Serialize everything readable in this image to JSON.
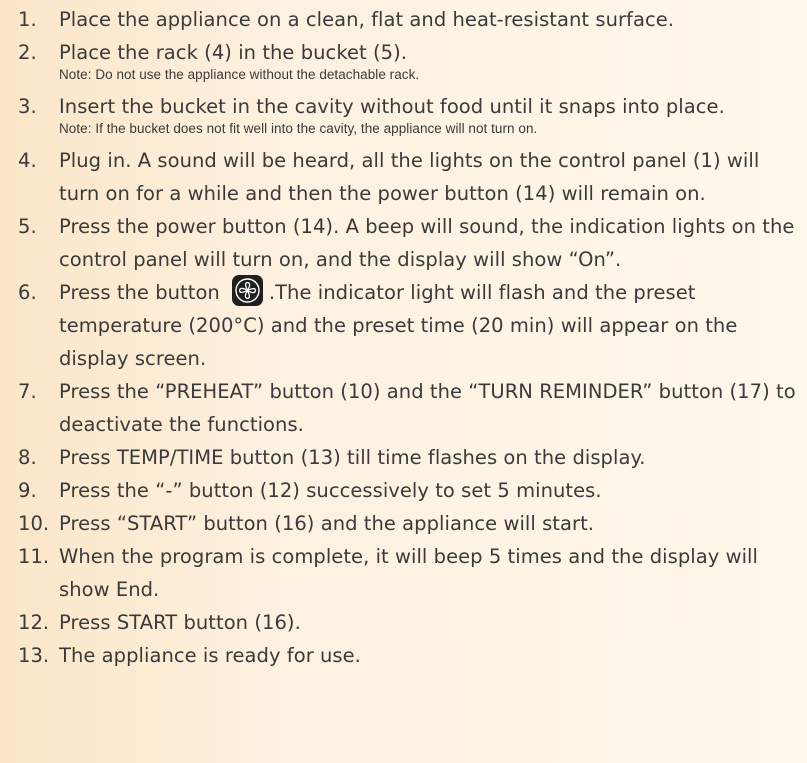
{
  "steps": [
    {
      "num": "1.",
      "text": "Place the appliance on a clean, flat and heat-resistant surface."
    },
    {
      "num": "2.",
      "text": "Place the rack (4) in the bucket (5).",
      "note": "Note: Do not use the appliance without the detachable rack."
    },
    {
      "num": "3.",
      "text": "Insert the bucket in the cavity without food until it snaps into place.",
      "note": "Note: If the bucket does not fit well into the cavity, the appliance will not turn on."
    },
    {
      "num": "4.",
      "text": "Plug in. A sound will be heard, all the lights on the control panel (1) will turn on for a while and then the power button (14) will remain on."
    },
    {
      "num": "5.",
      "text": "Press the power button (14). A beep will sound, the indication lights on the control panel will turn on, and the display will show “On”."
    },
    {
      "num": "6.",
      "text_before": "Press the button",
      "text_after": ".The indicator light will flash and the preset temperature (200°C) and the preset time (20 min) will appear on the display screen.",
      "icon": "fan-icon"
    },
    {
      "num": "7.",
      "text": "Press the “PREHEAT” button (10) and the “TURN REMINDER” button (17) to deactivate the functions."
    },
    {
      "num": "8.",
      "text": "Press TEMP/TIME button (13) till time flashes on the display."
    },
    {
      "num": "9.",
      "text": "Press the “-” button (12) successively to set 5 minutes."
    },
    {
      "num": "10.",
      "text": "Press “START” button (16) and the appliance will start."
    },
    {
      "num": "11.",
      "text": "When the program is complete, it will beep 5 times and the display will show End."
    },
    {
      "num": "12.",
      "text": "Press START button (16)."
    },
    {
      "num": "13.",
      "text": "The appliance is ready for use."
    }
  ],
  "colors": {
    "background_left": "#fbe6c8",
    "background_right": "#fff8ec",
    "text": "#3a3a3a",
    "icon_bg": "#1f1f1f",
    "icon_fg": "#ffffff"
  }
}
